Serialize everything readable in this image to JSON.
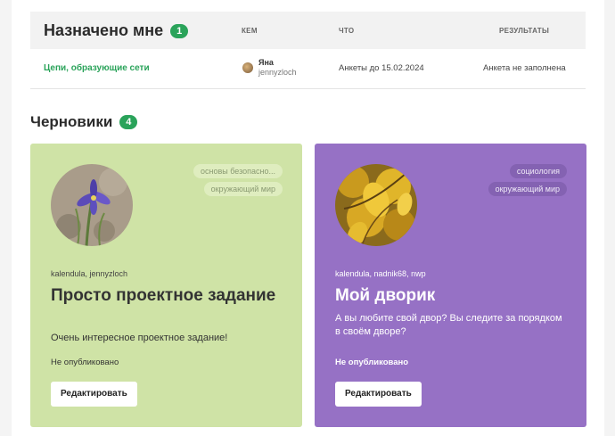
{
  "assigned": {
    "title": "Назначено мне",
    "count": "1",
    "columns": {
      "by": "КЕМ",
      "what": "ЧТО",
      "results": "РЕЗУЛЬТАТЫ"
    },
    "rows": [
      {
        "name": "Цепи, образующие сети",
        "user_name": "Яна",
        "user_login": "jennyzloch",
        "what": "Анкеты до 15.02.2024",
        "result": "Анкета не заполнена"
      }
    ]
  },
  "drafts": {
    "title": "Черновики",
    "count": "4",
    "cards": [
      {
        "theme": "green",
        "tags": [
          "основы безопасно...",
          "окружающий мир"
        ],
        "authors": "kalendula, jennyzloch",
        "title": "Просто проектное задание",
        "description": "Очень интересное проектное задание!",
        "status": "Не опубликовано",
        "edit_label": "Редактировать"
      },
      {
        "theme": "purple",
        "tags": [
          "социология",
          "окружающий мир"
        ],
        "authors": "kalendula, nadnik68, nwp",
        "title": "Мой дворик",
        "description": "А вы любите свой двор? Вы следите за порядком в своём дворе?",
        "status": "Не опубликовано",
        "edit_label": "Редактировать"
      }
    ]
  },
  "colors": {
    "accent_green": "#2aa35a",
    "card_green": "#cfe3a6",
    "card_purple": "#9671c5"
  }
}
